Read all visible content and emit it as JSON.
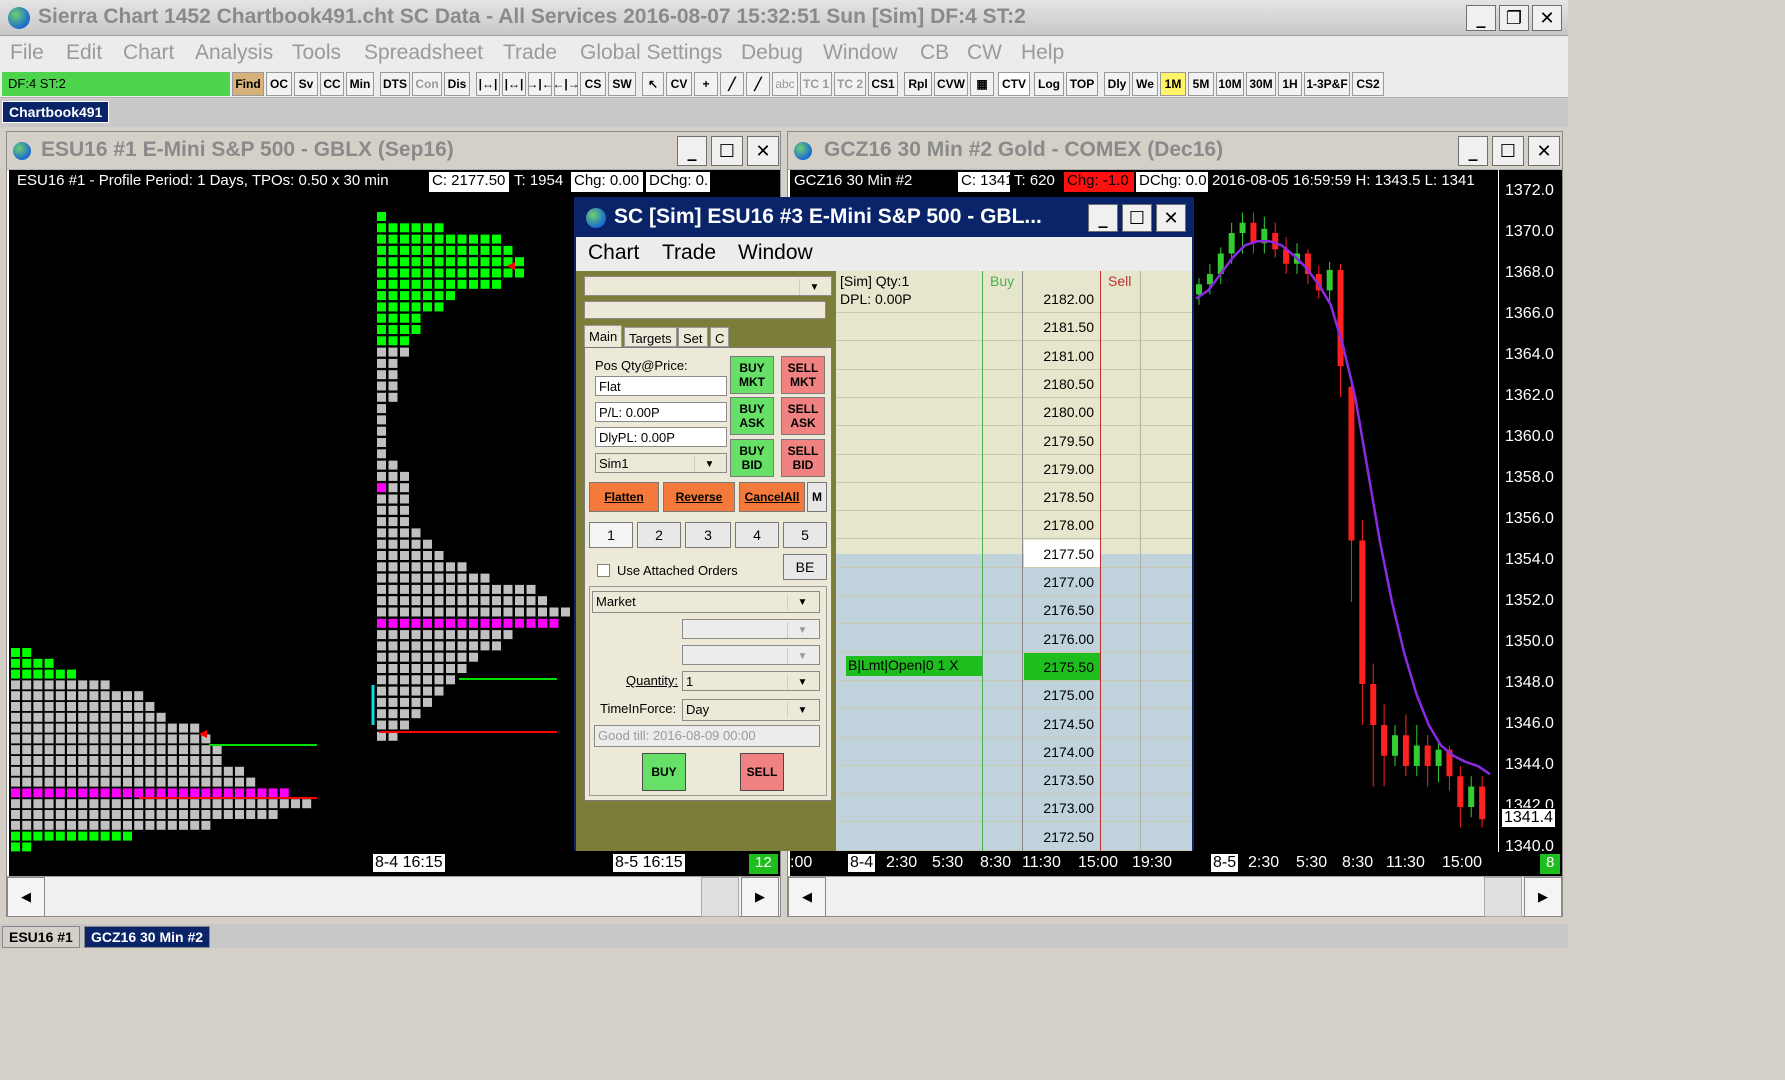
{
  "app": {
    "title": "Sierra Chart 1452 Chartbook491.cht  SC Data - All Services 2016-08-07  15:32:51 Sun [Sim]  DF:4  ST:2",
    "menu": [
      "File",
      "Edit",
      "Chart",
      "Analysis",
      "Tools",
      "Spreadsheet",
      "Trade",
      "Global Settings",
      "Debug",
      "Window",
      "CB",
      "CW",
      "Help"
    ]
  },
  "toolbar": {
    "status": "DF:4  ST:2",
    "buttons": [
      "Find",
      "OC",
      "Sv",
      "CC",
      "Min",
      "DTS",
      "Con",
      "Dis",
      "CS",
      "SW",
      "CV",
      "abc",
      "TC 1",
      "TC 2",
      "CS1",
      "Rpl",
      "CVW",
      "CTV",
      "Log",
      "TOP",
      "Dly",
      "We",
      "1M",
      "5M",
      "10M",
      "30M",
      "1H",
      "1-3P&F",
      "CS2"
    ]
  },
  "chartbook_tab": "Chartbook491",
  "chart1": {
    "title": "ESU16  #1  E-Mini S&P 500 - GBLX (Sep16)",
    "info": "ESU16  #1 - Profile Period: 1 Days, TPOs: 0.50 x 30 min",
    "close": "C: 2177.50",
    "trades": "T: 1954",
    "chg": "Chg: 0.00",
    "dchg": "DChg: 0.",
    "x_labels": [
      "8-4  16:15",
      "8-5  16:15"
    ],
    "badge": "12"
  },
  "chart2": {
    "title": "GCZ16  30 Min   #2  Gold - COMEX (Dec16)",
    "info_sym": "GCZ16  30 Min   #2",
    "close": "C: 1341.4",
    "trades": "T: 620",
    "chg": "Chg: -1.0",
    "dchg": "DChg: 0.0",
    "ohlc": "2016-08-05 16:59:59 H: 1343.5 L: 1341",
    "x_labels": [
      ":00",
      "8-4",
      "2:30",
      "5:30",
      "8:30",
      "11:30",
      "15:00",
      "19:30",
      "8-5",
      "2:30",
      "5:30",
      "8:30",
      "11:30",
      "15:00"
    ],
    "badge": "8",
    "y_labels": [
      "1372.0",
      "1370.0",
      "1368.0",
      "1366.0",
      "1364.0",
      "1362.0",
      "1360.0",
      "1358.0",
      "1356.0",
      "1354.0",
      "1352.0",
      "1350.0",
      "1348.0",
      "1346.0",
      "1344.0",
      "1342.0",
      "1340.0"
    ],
    "last_price": "1341.4"
  },
  "trade_window": {
    "title": "SC [Sim] ESU16  #3  E-Mini S&P 500 - GBL...",
    "menu": [
      "Chart",
      "Trade",
      "Window"
    ],
    "tabs": [
      "Main",
      "Targets",
      "Set",
      "C"
    ],
    "pos_label": "Pos Qty@Price:",
    "pos_value": "Flat",
    "pl": "P/L: 0.00P",
    "dlypl": "DlyPL: 0.00P",
    "account": "Sim1",
    "buy_mkt": "BUY\nMKT",
    "sell_mkt": "SELL\nMKT",
    "buy_ask": "BUY\nASK",
    "sell_ask": "SELL\nASK",
    "buy_bid": "BUY\nBID",
    "sell_bid": "SELL\nBID",
    "flatten": "Flatten",
    "reverse": "Reverse",
    "cancelall": "CancelAll",
    "m": "M",
    "qty_buttons": [
      "1",
      "2",
      "3",
      "4",
      "5"
    ],
    "use_attached": "Use Attached Orders",
    "be": "BE",
    "order_type": "Market",
    "quantity_label": "Quantity:",
    "quantity": "1",
    "tif_label": "TimeInForce:",
    "tif": "Day",
    "good_till": "Good till: 2016-08-09 00:00",
    "buy": "BUY",
    "sell": "SELL",
    "dom_header": {
      "sim_qty": "[Sim]  Qty:1",
      "dpl": "DPL: 0.00P",
      "buy": "Buy",
      "sell": "Sell"
    },
    "dom_prices": [
      "2182.00",
      "2181.50",
      "2181.00",
      "2180.50",
      "2180.00",
      "2179.50",
      "2179.00",
      "2178.50",
      "2178.00",
      "2177.50",
      "2177.00",
      "2176.50",
      "2176.00",
      "2175.50",
      "2175.00",
      "2174.50",
      "2174.00",
      "2173.50",
      "2173.00",
      "2172.50"
    ],
    "dom_current": "2177.50",
    "working_order": "B|Lmt|Open|0  1  X",
    "working_price": "2175.50"
  },
  "bottom_tabs": [
    "ESU16  #1",
    "GCZ16  30 Min   #2"
  ],
  "colors": {
    "accent": "#0a246a",
    "green": "#00ff00",
    "magenta": "#ff00ff",
    "tpo_gray": "#c0c0c0",
    "ma_line": "#8a2be2"
  }
}
